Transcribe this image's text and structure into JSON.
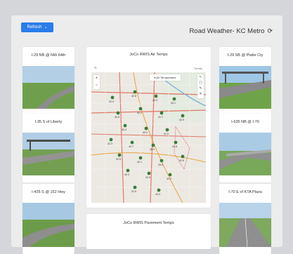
{
  "header": {
    "title": "Road Weather- KC Metro",
    "refresh_label": "Refresh",
    "refresh_arrow": "⌄",
    "reload_glyph": "⟳"
  },
  "cameras": [
    {
      "label": "I-29 SB @ Platte Cty"
    },
    {
      "label": "I-635 NB @ I-70"
    },
    {
      "label": "I-70 E of KTA Plaza"
    },
    {
      "label": "I-29 NB @ NW 64th"
    },
    {
      "label": "I-35 S of Liberty"
    },
    {
      "label": "I-435 S @ 152 Hwy"
    }
  ],
  "map_card": {
    "label": "JoCo RWIS Air Temps",
    "topbar_text": "Terrain",
    "legend": "▾ Air Temperature",
    "menu_glyph": "☰",
    "zoom_in": "+",
    "zoom_out": "−",
    "tool_glyphs": [
      "↖",
      "▢",
      "✎",
      "✕"
    ],
    "stations": [
      "42.4",
      "42.8",
      "41.9",
      "43.1",
      "42.6",
      "42.2",
      "41.7",
      "42.9",
      "43.4",
      "42.0",
      "41.5",
      "42.3",
      "42.7",
      "43.0",
      "41.8",
      "42.5",
      "42.1",
      "43.2",
      "41.6",
      "42.4",
      "42.9",
      "42.2",
      "41.9",
      "43.3"
    ]
  },
  "pavement_card": {
    "label": "JoCo RWIS Pavement Temps"
  },
  "colors": {
    "accent": "#2b7de9",
    "station": "#3a7d3a",
    "grass": "#6fa34a",
    "sky": "#9fc7e6"
  }
}
